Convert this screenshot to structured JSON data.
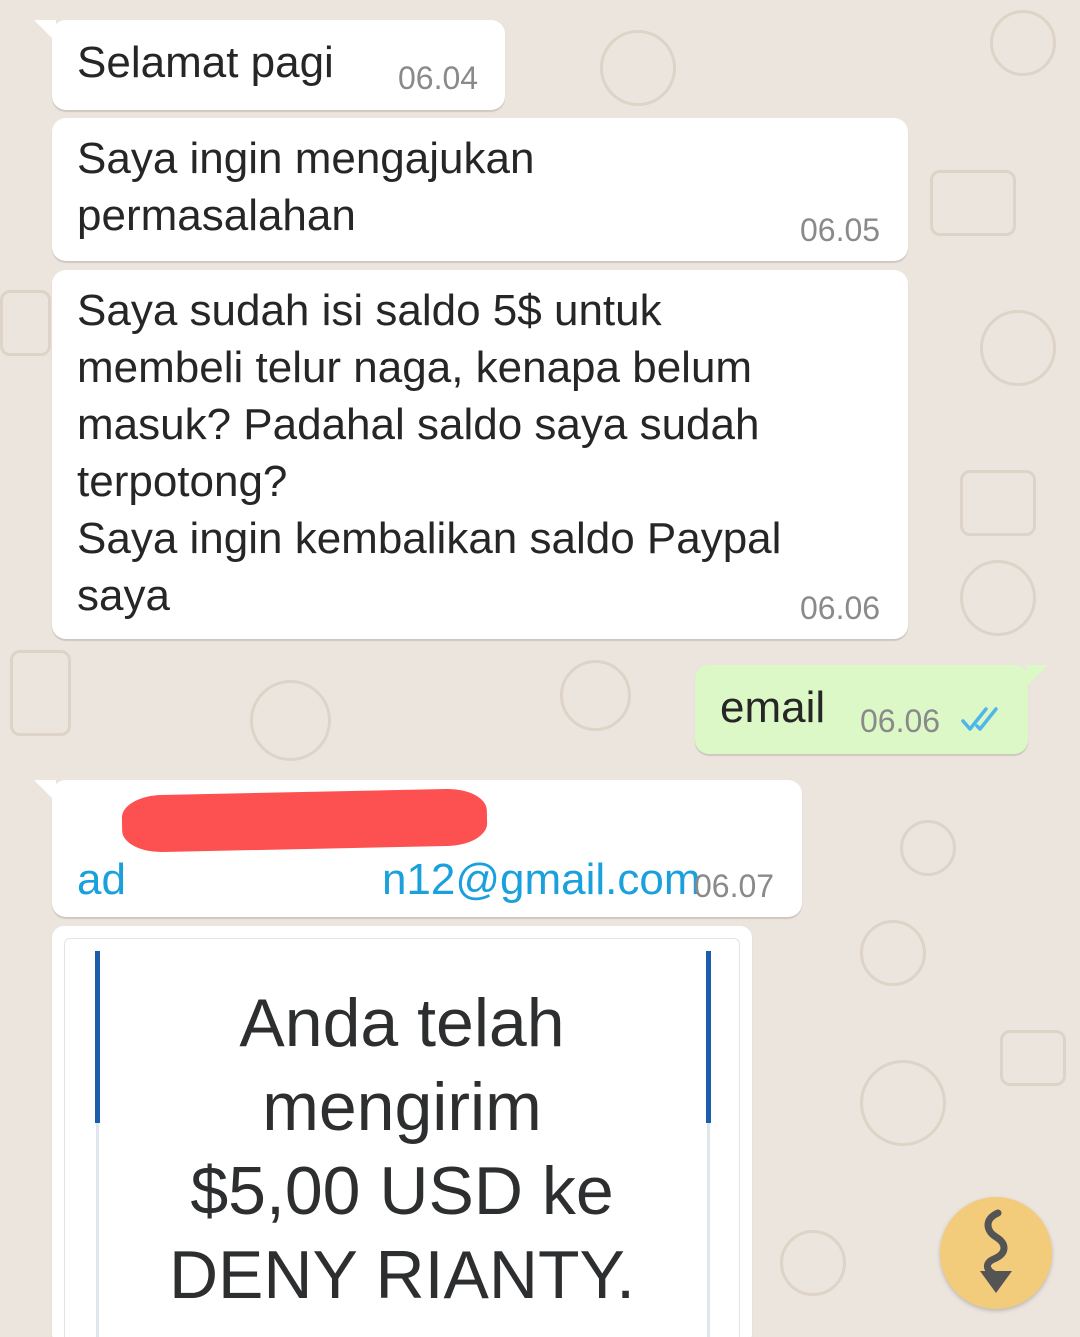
{
  "messages": [
    {
      "direction": "incoming",
      "text": "Selamat pagi",
      "time": "06.04"
    },
    {
      "direction": "incoming",
      "text": "Saya ingin mengajukan\npermasalahan",
      "time": "06.05"
    },
    {
      "direction": "incoming",
      "text": "Saya sudah isi saldo 5$ untuk\nmembeli telur naga, kenapa belum\nmasuk? Padahal saldo saya sudah\nterpotong?\nSaya ingin kembalikan saldo Paypal\nsaya",
      "time": "06.06"
    },
    {
      "direction": "outgoing",
      "text": "email",
      "time": "06.06",
      "status_icon": "double-check-read-icon"
    },
    {
      "direction": "incoming",
      "link_prefix": "ad",
      "link_suffix": "n12@gmail.com",
      "time": "06.07",
      "redacted": true
    },
    {
      "direction": "incoming",
      "image_text": "Anda telah\nmengirim\n$5,00 USD ke\nDENY RIANTY."
    }
  ],
  "scroll_button": {
    "icon": "scroll-down-arrow-icon"
  },
  "colors": {
    "background": "#ece5dd",
    "incoming_bubble": "#ffffff",
    "outgoing_bubble": "#dcf8c6",
    "link": "#1aa0dd",
    "read_ticks": "#4fb6ec",
    "redaction": "#fd5050",
    "scroll_button": "#f2cc7b",
    "receipt_rule": "#1b5faa"
  }
}
